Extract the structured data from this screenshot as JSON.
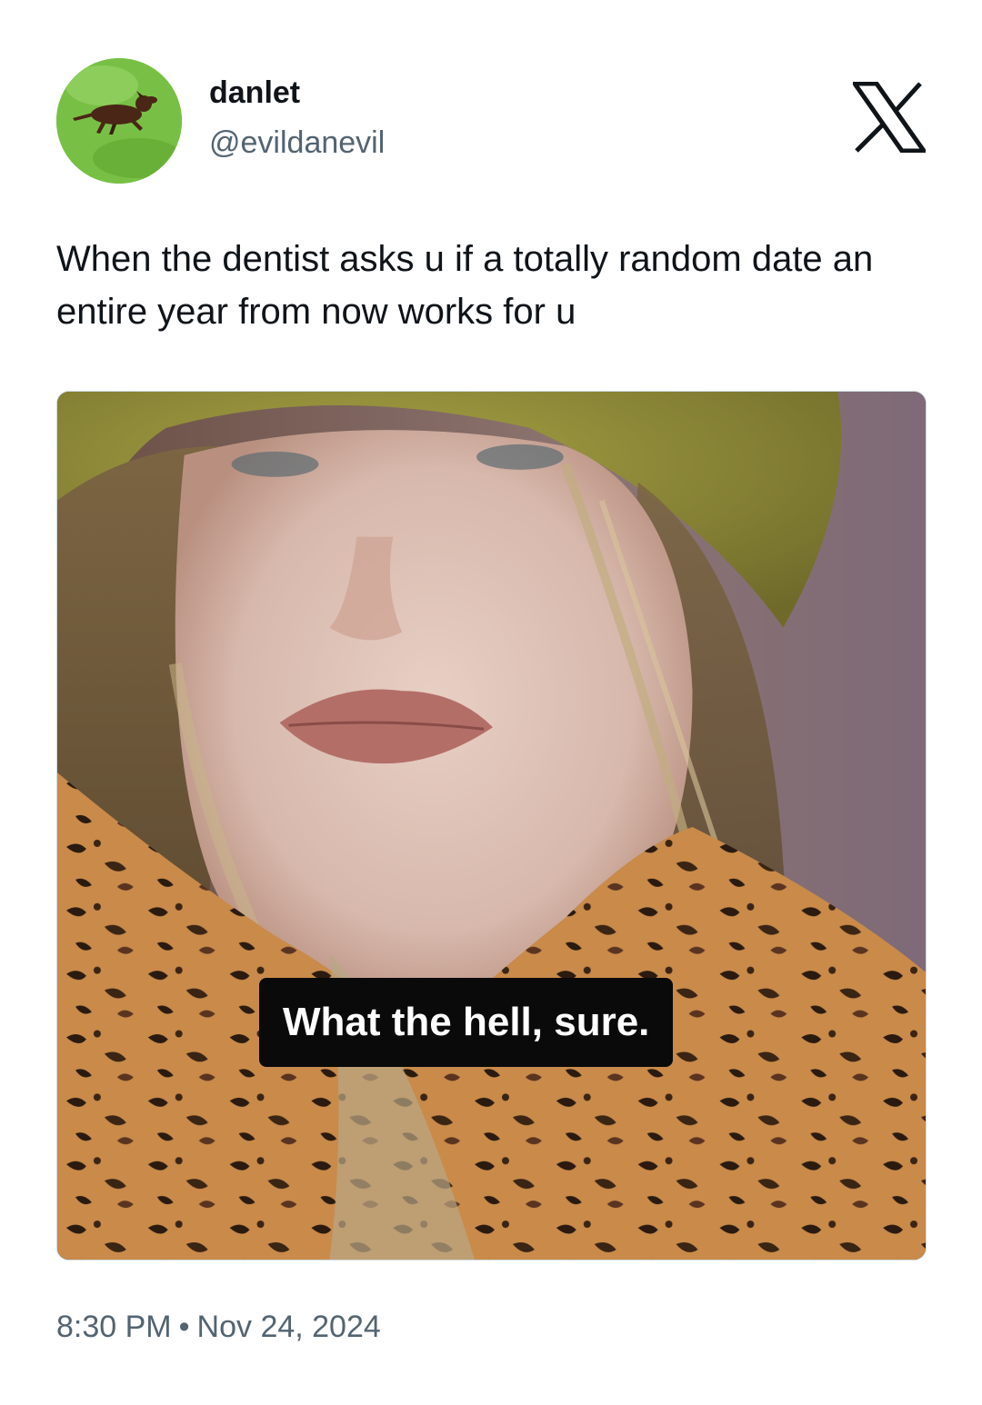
{
  "author": {
    "display_name": "danlet",
    "handle": "@evildanevil",
    "avatar_icon": "dachshund-avatar-icon"
  },
  "platform_icon": "x-logo-icon",
  "tweet": {
    "text": "When the dentist asks u if a totally random date an entire year from now works for u",
    "media_caption": "What the hell, sure."
  },
  "footer": {
    "time": "8:30 PM",
    "separator": "•",
    "date": "Nov 24, 2024"
  },
  "colors": {
    "text_primary": "#0f1419",
    "text_secondary": "#536471",
    "caption_bg": "#0a0a0a"
  }
}
